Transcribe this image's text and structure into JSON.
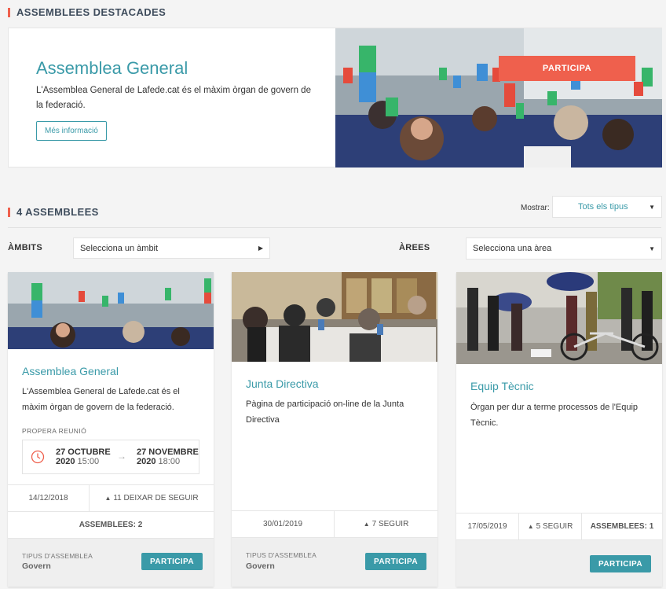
{
  "highlighted": {
    "heading": "ASSEMBLEES DESTACADES",
    "title": "Assemblea General",
    "description": "L'Assemblea General de Lafede.cat és el màxim òrgan de govern de la federació.",
    "more_info_label": "Més informació",
    "participa_label": "PARTICIPA"
  },
  "list": {
    "heading": "4 ASSEMBLEES",
    "mostrar_label": "Mostrar:",
    "type_filter_value": "Tots els tipus",
    "ambits_label": "ÀMBITS",
    "ambits_placeholder": "Selecciona un àmbit",
    "arees_label": "ÀREES",
    "arees_placeholder": "Selecciona una àrea"
  },
  "cards": [
    {
      "title": "Assemblea General",
      "description": "L'Assemblea General de Lafede.cat és el màxim òrgan de govern de la federació.",
      "meeting_label": "PROPERA REUNIÓ",
      "start_date": "27 OCTUBRE",
      "start_year": "2020",
      "start_time": "15:00",
      "end_date": "27 NOVEMBRE",
      "end_year": "2020",
      "end_time": "18:00",
      "date": "14/12/2018",
      "follow": "11 DEIXAR DE SEGUIR",
      "assemblies": "ASSEMBLEES: 2",
      "type_label": "TIPUS D'ASSEMBLEA",
      "type_value": "Govern",
      "participa_label": "PARTICIPA"
    },
    {
      "title": "Junta Directiva",
      "description": "Pàgina de participació on-line de la Junta Directiva",
      "date": "30/01/2019",
      "follow": "7 SEGUIR",
      "type_label": "TIPUS D'ASSEMBLEA",
      "type_value": "Govern",
      "participa_label": "PARTICIPA"
    },
    {
      "title": "Equip Tècnic",
      "description": "Òrgan per dur a terme processos de l'Equip Tècnic.",
      "date": "17/05/2019",
      "follow": "5 SEGUIR",
      "assemblies": "ASSEMBLEES: 1",
      "participa_label": "PARTICIPA"
    }
  ],
  "icons": {
    "caret": "caret-down-icon",
    "arrow": "arrow-right-icon",
    "clock": "clock-icon",
    "bell": "bell-icon"
  },
  "colors": {
    "accent": "#3a9aa8",
    "highlight": "#ef604d"
  }
}
